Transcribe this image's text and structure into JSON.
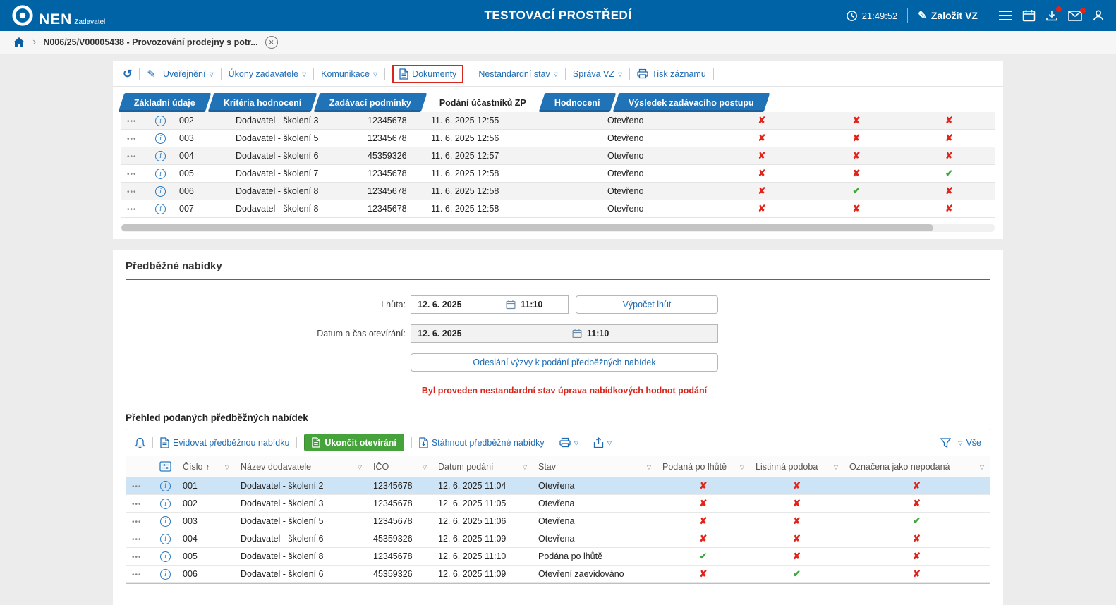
{
  "header": {
    "logo_text": "NEN",
    "logo_subtitle": "Zadavatel",
    "env_title": "TESTOVACÍ PROSTŘEDÍ",
    "time": "21:49:52",
    "create_vz_label": "Založit VZ"
  },
  "breadcrumb": {
    "item": "N006/25/V00005438 - Provozování prodejny s potr..."
  },
  "toolbar": {
    "uverejneni": "Uveřejnění",
    "ukony_zadavatele": "Úkony zadavatele",
    "komunikace": "Komunikace",
    "dokumenty": "Dokumenty",
    "nestandardni_stav": "Nestandardní stav",
    "sprava_vz": "Správa VZ",
    "tisk_zaznamu": "Tisk záznamu"
  },
  "tabs": [
    {
      "label": "Základní údaje",
      "active": false
    },
    {
      "label": "Kritéria hodnocení",
      "active": false
    },
    {
      "label": "Zadávací podmínky",
      "active": false
    },
    {
      "label": "Podání účastníků ZP",
      "active": true
    },
    {
      "label": "Hodnocení",
      "active": false
    },
    {
      "label": "Výsledek zadávacího postupu",
      "active": false
    }
  ],
  "participants": {
    "rows": [
      {
        "number": "002",
        "supplier": "Dodavatel - školení 3",
        "ico": "12345678",
        "date": "11. 6. 2025 12:55",
        "status": "Otevřeno",
        "m1": "x",
        "m2": "x",
        "m3": "x"
      },
      {
        "number": "003",
        "supplier": "Dodavatel - školení 5",
        "ico": "12345678",
        "date": "11. 6. 2025 12:56",
        "status": "Otevřeno",
        "m1": "x",
        "m2": "x",
        "m3": "x"
      },
      {
        "number": "004",
        "supplier": "Dodavatel - školení 6",
        "ico": "45359326",
        "date": "11. 6. 2025 12:57",
        "status": "Otevřeno",
        "m1": "x",
        "m2": "x",
        "m3": "x"
      },
      {
        "number": "005",
        "supplier": "Dodavatel - školení 7",
        "ico": "12345678",
        "date": "11. 6. 2025 12:58",
        "status": "Otevřeno",
        "m1": "x",
        "m2": "x",
        "m3": "check"
      },
      {
        "number": "006",
        "supplier": "Dodavatel - školení 8",
        "ico": "12345678",
        "date": "11. 6. 2025 12:58",
        "status": "Otevřeno",
        "m1": "x",
        "m2": "check",
        "m3": "x"
      },
      {
        "number": "007",
        "supplier": "Dodavatel - školení 8",
        "ico": "12345678",
        "date": "11. 6. 2025 12:58",
        "status": "Otevřeno",
        "m1": "x",
        "m2": "x",
        "m3": "x"
      }
    ]
  },
  "preliminary": {
    "section_title": "Předběžné nabídky",
    "lhuta_label": "Lhůta:",
    "lhuta_date": "12. 6. 2025",
    "lhuta_time": "11:10",
    "vypocet_button": "Výpočet lhůt",
    "otevirani_label": "Datum a čas otevírání:",
    "otevirani_date": "12. 6. 2025",
    "otevirani_time": "11:10",
    "odeslani_button": "Odeslání výzvy k podání předběžných nabídek",
    "warning": "Byl proveden nestandardní stav úprava nabídkových hodnot podání",
    "overview_title": "Přehled podaných předběžných nabídek"
  },
  "offers": {
    "toolbar": {
      "evidovat": "Evidovat předběžnou nabídku",
      "ukoncit": "Ukončit otevírání",
      "stahnout": "Stáhnout předběžné nabídky",
      "vse": "Vše"
    },
    "columns": {
      "cislo": "Číslo",
      "nazev": "Název dodavatele",
      "ico": "IČO",
      "datum": "Datum podání",
      "stav": "Stav",
      "podana": "Podaná po lhůtě",
      "listinna": "Listinná podoba",
      "oznacena": "Označena jako nepodaná"
    },
    "rows": [
      {
        "number": "001",
        "supplier": "Dodavatel - školení 2",
        "ico": "12345678",
        "date": "12. 6. 2025 11:04",
        "status": "Otevřena",
        "late": "x",
        "paper": "x",
        "notsubmitted": "x",
        "selected": true
      },
      {
        "number": "002",
        "supplier": "Dodavatel - školení 3",
        "ico": "12345678",
        "date": "12. 6. 2025 11:05",
        "status": "Otevřena",
        "late": "x",
        "paper": "x",
        "notsubmitted": "x"
      },
      {
        "number": "003",
        "supplier": "Dodavatel - školení 5",
        "ico": "12345678",
        "date": "12. 6. 2025 11:06",
        "status": "Otevřena",
        "late": "x",
        "paper": "x",
        "notsubmitted": "check"
      },
      {
        "number": "004",
        "supplier": "Dodavatel - školení 6",
        "ico": "45359326",
        "date": "12. 6. 2025 11:09",
        "status": "Otevřena",
        "late": "x",
        "paper": "x",
        "notsubmitted": "x"
      },
      {
        "number": "005",
        "supplier": "Dodavatel - školení 8",
        "ico": "12345678",
        "date": "12. 6. 2025 11:10",
        "status": "Podána po lhůtě",
        "late": "check",
        "paper": "x",
        "notsubmitted": "x"
      },
      {
        "number": "006",
        "supplier": "Dodavatel - školení 6",
        "ico": "45359326",
        "date": "12. 6. 2025 11:09",
        "status": "Otevření zaevidováno",
        "late": "x",
        "paper": "check",
        "notsubmitted": "x"
      }
    ]
  },
  "colors": {
    "header_bg": "#0063a6",
    "accent_blue": "#1e6cb5",
    "tab_blue": "#2173b8",
    "alert_red": "#d9261c",
    "success_green": "#3da639",
    "selected_row": "#cde4f6",
    "button_green": "#46a33c"
  }
}
